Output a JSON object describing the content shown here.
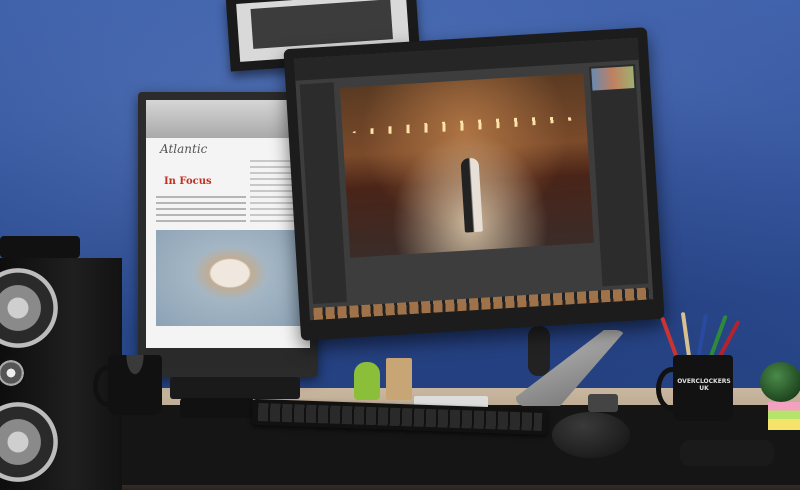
{
  "scene": {
    "description_free_text": "",
    "left_monitor": {
      "logo": "Atlantic",
      "headline": "In Focus"
    },
    "mug_right": {
      "text": "OVERCLOCKERS UK"
    },
    "colors": {
      "wall": "#2f4f97",
      "desk": "#c9b7a0",
      "lightroom_ui": "#3d3d3d"
    }
  }
}
